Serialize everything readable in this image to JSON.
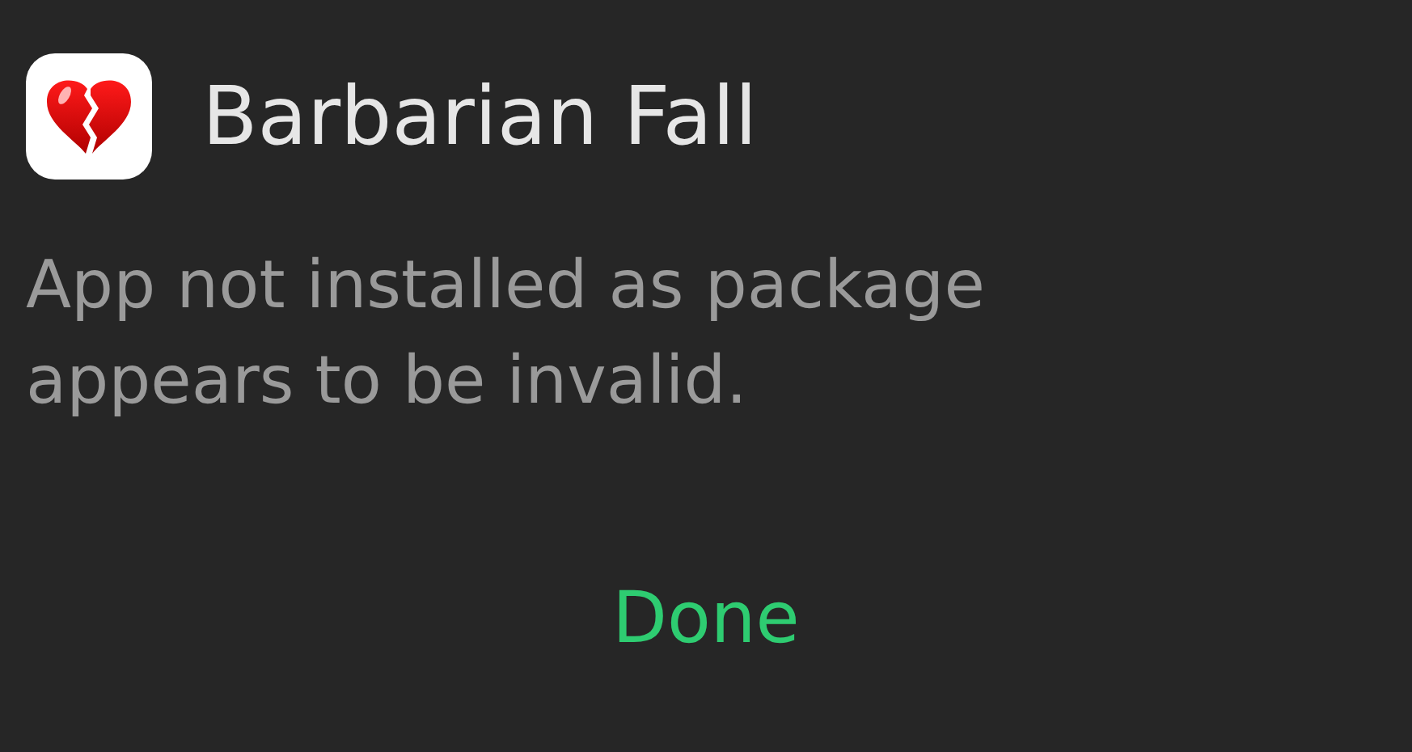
{
  "dialog": {
    "title": "Barbarian Fall",
    "message": "App not installed as package appears to be invalid.",
    "buttons": [
      "Done"
    ]
  }
}
